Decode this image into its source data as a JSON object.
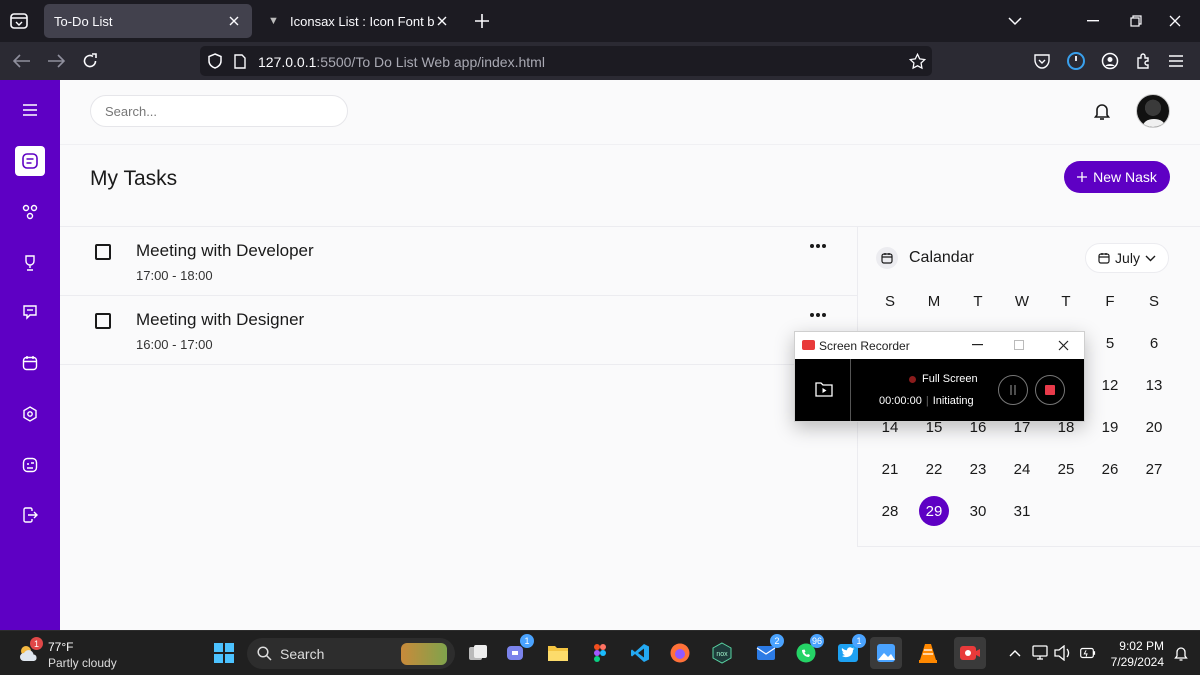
{
  "browser": {
    "tabs": [
      {
        "title": "To-Do List",
        "active": true
      },
      {
        "title": "Iconsax List : Icon Font by Vuesax",
        "active": false
      }
    ],
    "url_host": "127.0.0.1",
    "url_path": ":5500/To Do List Web app/index.html"
  },
  "app": {
    "search_placeholder": "Search...",
    "page_title": "My Tasks",
    "new_task_label": "New Nask",
    "new_task_icon": "plus-icon",
    "accent_color": "#5e00c4",
    "sidebar_icons": [
      "menu-icon",
      "tasks-icon",
      "team-icon",
      "trophy-icon",
      "messages-icon",
      "calendar-icon",
      "settings-icon",
      "profile-icon",
      "logout-icon"
    ],
    "tasks": [
      {
        "title": "Meeting with Developer",
        "start": "17:00",
        "end": "18:00",
        "completed": false
      },
      {
        "title": "Meeting with Designer",
        "start": "16:00",
        "end": "17:00",
        "completed": false
      }
    ],
    "calendar": {
      "title": "Calandar",
      "month": "July",
      "weekdays": [
        "S",
        "M",
        "T",
        "W",
        "T",
        "F",
        "S"
      ],
      "visible_days": [
        {
          "day": "5",
          "col": 5,
          "row": 0
        },
        {
          "day": "6",
          "col": 6,
          "row": 0
        },
        {
          "day": "12",
          "col": 5,
          "row": 1
        },
        {
          "day": "13",
          "col": 6,
          "row": 1
        },
        {
          "day": "14",
          "col": 0,
          "row": 2
        },
        {
          "day": "15",
          "col": 1,
          "row": 2
        },
        {
          "day": "16",
          "col": 2,
          "row": 2
        },
        {
          "day": "17",
          "col": 3,
          "row": 2
        },
        {
          "day": "18",
          "col": 4,
          "row": 2
        },
        {
          "day": "19",
          "col": 5,
          "row": 2
        },
        {
          "day": "20",
          "col": 6,
          "row": 2
        },
        {
          "day": "21",
          "col": 0,
          "row": 3
        },
        {
          "day": "22",
          "col": 1,
          "row": 3
        },
        {
          "day": "23",
          "col": 2,
          "row": 3
        },
        {
          "day": "24",
          "col": 3,
          "row": 3
        },
        {
          "day": "25",
          "col": 4,
          "row": 3
        },
        {
          "day": "26",
          "col": 5,
          "row": 3
        },
        {
          "day": "27",
          "col": 6,
          "row": 3
        },
        {
          "day": "28",
          "col": 0,
          "row": 4
        },
        {
          "day": "29",
          "col": 1,
          "row": 4
        },
        {
          "day": "30",
          "col": 2,
          "row": 4
        },
        {
          "day": "31",
          "col": 3,
          "row": 4
        }
      ],
      "selected_day": "29"
    }
  },
  "recorder": {
    "title": "Screen Recorder",
    "mode": "Full Screen",
    "time": "00:00:00",
    "status": "Initiating"
  },
  "taskbar": {
    "weather_temp": "77°F",
    "weather_condition": "Partly cloudy",
    "weather_badge": "1",
    "search_label": "Search",
    "badges": {
      "teams": "1",
      "edge_mail": "2",
      "whatsapp": "96",
      "twitter": "1"
    },
    "time": "9:02 PM",
    "date": "7/29/2024"
  }
}
